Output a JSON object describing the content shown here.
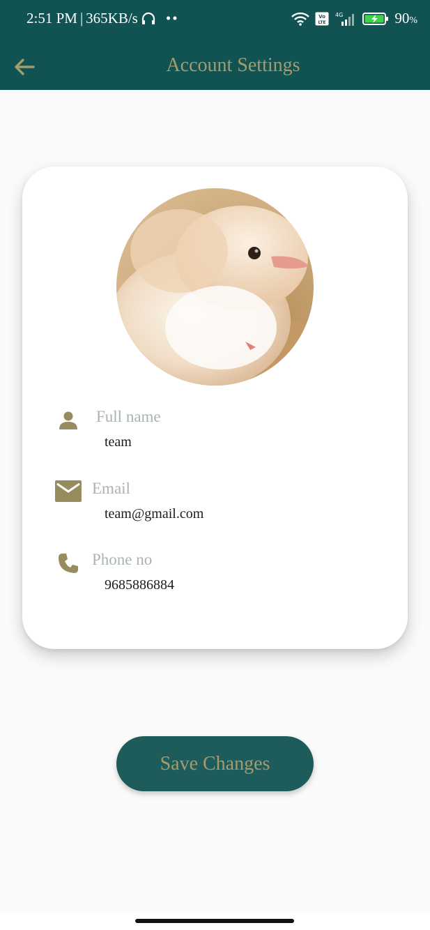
{
  "status_bar": {
    "time": "2:51 PM",
    "separator": "|",
    "speed": "365KB/s",
    "dots": "••",
    "battery": "90",
    "battery_unit": "%",
    "network": "4G",
    "volte": "Vo LTE"
  },
  "header": {
    "title": "Account Settings",
    "background": "#115353",
    "accent": "#a59b6d"
  },
  "profile": {
    "fields": [
      {
        "label": "Full name",
        "value": "team",
        "icon": "person-icon"
      },
      {
        "label": "Email",
        "value": "team@gmail.com",
        "icon": "mail-icon"
      },
      {
        "label": "Phone no",
        "value": "9685886884",
        "icon": "phone-icon"
      }
    ]
  },
  "actions": {
    "save_label": "Save Changes",
    "button_color": "#1e5c5b"
  }
}
